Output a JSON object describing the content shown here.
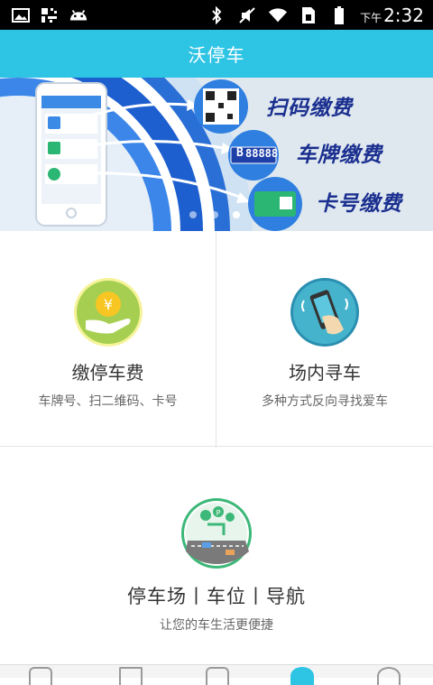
{
  "status_bar": {
    "ampm": "下午",
    "time": "2:32",
    "icons": [
      "image-icon",
      "qr-icon",
      "android-icon",
      "bluetooth-icon",
      "mute-icon",
      "wifi-icon",
      "sim-icon",
      "battery-icon"
    ]
  },
  "header": {
    "title": "沃停车"
  },
  "banner": {
    "features": [
      "扫码缴费",
      "车牌缴费",
      "卡号缴费"
    ],
    "plate_text": "88888",
    "plate_prefix": "B",
    "dots_count": 3,
    "active_dot": 2
  },
  "menu": [
    {
      "title": "缴停车费",
      "subtitle": "车牌号、扫二维码、卡号",
      "icon": "coin-hand-icon"
    },
    {
      "title": "场内寻车",
      "subtitle": "多种方式反向寻找爱车",
      "icon": "phone-hand-icon"
    },
    {
      "title": "停车场丨车位丨导航",
      "subtitle": "让您的车生活更便捷",
      "icon": "map-navigation-icon"
    }
  ],
  "colors": {
    "accent": "#2ec4e4",
    "banner_text": "#1a2f8f"
  }
}
